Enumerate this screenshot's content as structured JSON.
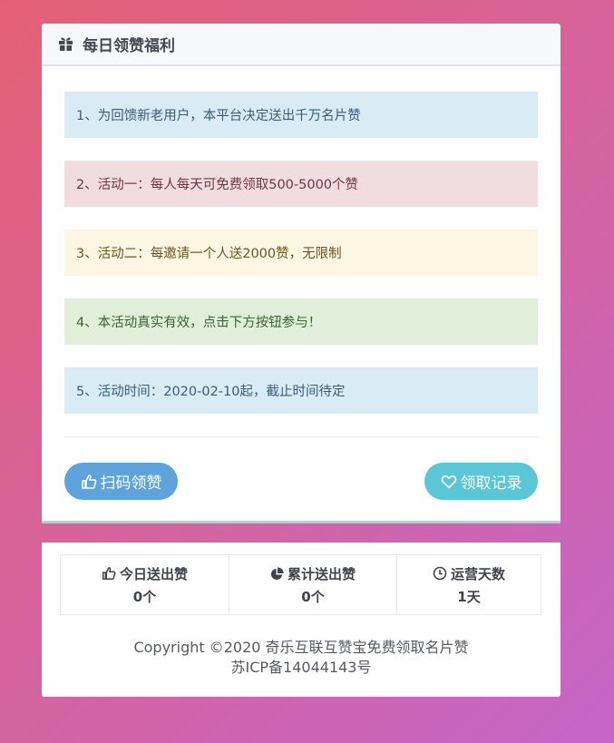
{
  "panel": {
    "title": "每日领赞福利",
    "title_icon": "gift-icon",
    "notices": [
      "1、为回馈新老用户，本平台决定送出千万名片赞",
      "2、活动一：每人每天可免费领取500-5000个赞",
      "3、活动二：每邀请一个人送2000赞，无限制",
      "4、本活动真实有效，点击下方按钮参与！",
      "5、活动时间：2020-02-10起，截止时间待定"
    ],
    "buttons": {
      "scan_label": "扫码领赞",
      "scan_icon": "thumbs-up-icon",
      "records_label": "领取记录",
      "records_icon": "heart-icon"
    }
  },
  "stats": [
    {
      "label": "今日送出赞",
      "value": "0个",
      "icon": "thumbs-up-icon"
    },
    {
      "label": "累计送出赞",
      "value": "0个",
      "icon": "pie-chart-icon"
    },
    {
      "label": "运营天数",
      "value": "1天",
      "icon": "clock-icon"
    }
  ],
  "footer": {
    "copyright": "Copyright ©2020 奇乐互联互赞宝免费领取名片赞",
    "icp": "苏ICP备14044143号"
  },
  "colors": {
    "info": "#d9ecf6",
    "danger": "#f1dcdf",
    "warning": "#fdf6e2",
    "success": "#dfefd9",
    "button_primary": "#5fa3dc",
    "button_info": "#5ac6d6"
  }
}
